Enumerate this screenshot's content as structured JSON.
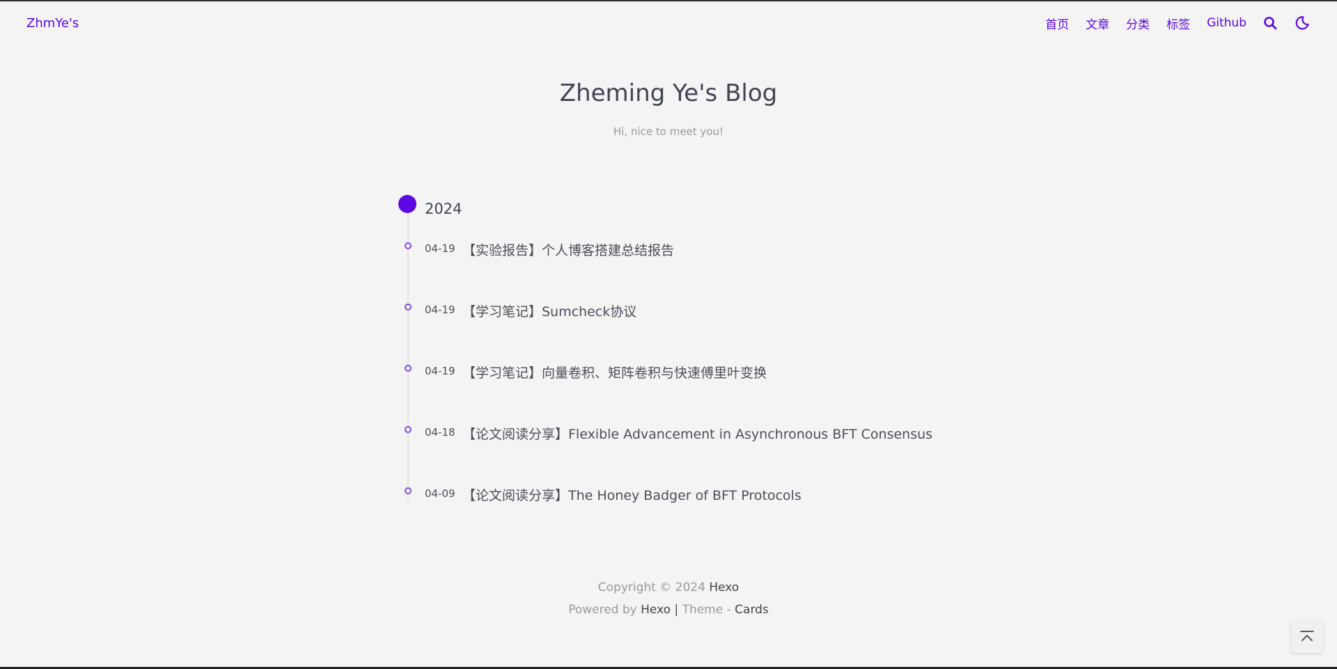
{
  "navbar": {
    "brand": "ZhmYe's",
    "links": [
      "首页",
      "文章",
      "分类",
      "标签",
      "Github"
    ],
    "icons": [
      "search-icon",
      "moon-icon"
    ]
  },
  "header": {
    "title": "Zheming Ye's Blog",
    "subtitle": "Hi, nice to meet you!"
  },
  "timeline": {
    "year": "2024",
    "posts": [
      {
        "date": "04-19",
        "title": "【实验报告】个人博客搭建总结报告"
      },
      {
        "date": "04-19",
        "title": "【学习笔记】Sumcheck协议"
      },
      {
        "date": "04-19",
        "title": "【学习笔记】向量卷积、矩阵卷积与快速傅里叶变换"
      },
      {
        "date": "04-18",
        "title": "【论文阅读分享】Flexible Advancement in Asynchronous BFT Consensus"
      },
      {
        "date": "04-09",
        "title": "【论文阅读分享】The Honey Badger of BFT Protocols"
      }
    ]
  },
  "footer": {
    "copyright_prefix": "Copyright © 2024",
    "copyright_owner": "Hexo",
    "powered_prefix": "Powered by",
    "powered_link": "Hexo",
    "separator": "|",
    "theme_prefix": "Theme -",
    "theme_link": "Cards"
  },
  "colors": {
    "accent": "#5d07e2",
    "text": "#3d4653",
    "muted": "#999999",
    "background": "#f4f4f4"
  }
}
